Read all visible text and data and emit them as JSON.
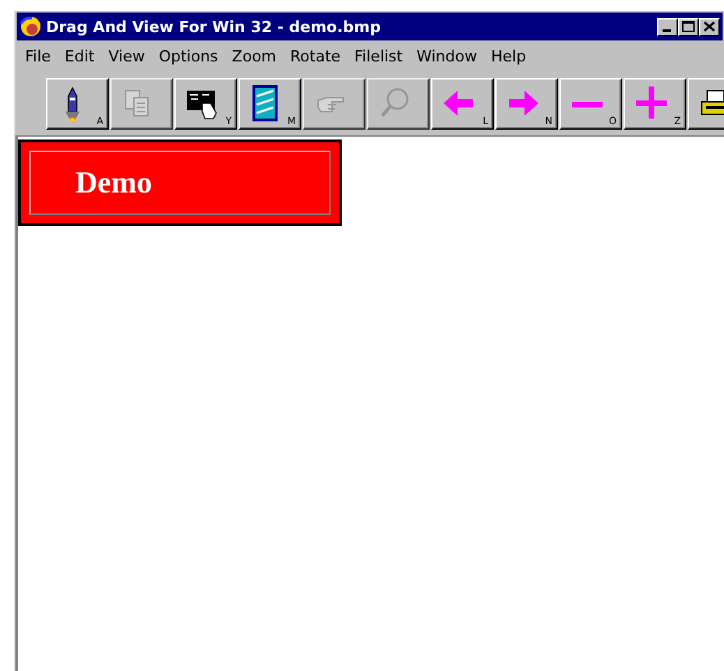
{
  "window": {
    "title": "Drag And View For Win 32 - demo.bmp",
    "controls": [
      {
        "kind": "minimize"
      },
      {
        "kind": "maximize"
      },
      {
        "kind": "close"
      }
    ]
  },
  "menu": [
    "File",
    "Edit",
    "View",
    "Options",
    "Zoom",
    "Rotate",
    "Filelist",
    "Window",
    "Help"
  ],
  "toolbar": [
    {
      "kind": "rocket",
      "hotkey": "A",
      "disabled": false
    },
    {
      "kind": "copy",
      "disabled": true
    },
    {
      "kind": "hand-picture",
      "hotkey": "Y",
      "disabled": false
    },
    {
      "kind": "window",
      "hotkey": "M",
      "disabled": false
    },
    {
      "kind": "pointer",
      "disabled": true
    },
    {
      "kind": "magnifier",
      "disabled": true
    },
    {
      "kind": "left",
      "hotkey": "L",
      "disabled": false
    },
    {
      "kind": "right",
      "hotkey": "N",
      "disabled": false
    },
    {
      "kind": "minus",
      "hotkey": "O",
      "disabled": false
    },
    {
      "kind": "plus",
      "hotkey": "Z",
      "disabled": false
    },
    {
      "kind": "printer",
      "disabled": false
    }
  ],
  "document": {
    "banner": "Demo"
  }
}
